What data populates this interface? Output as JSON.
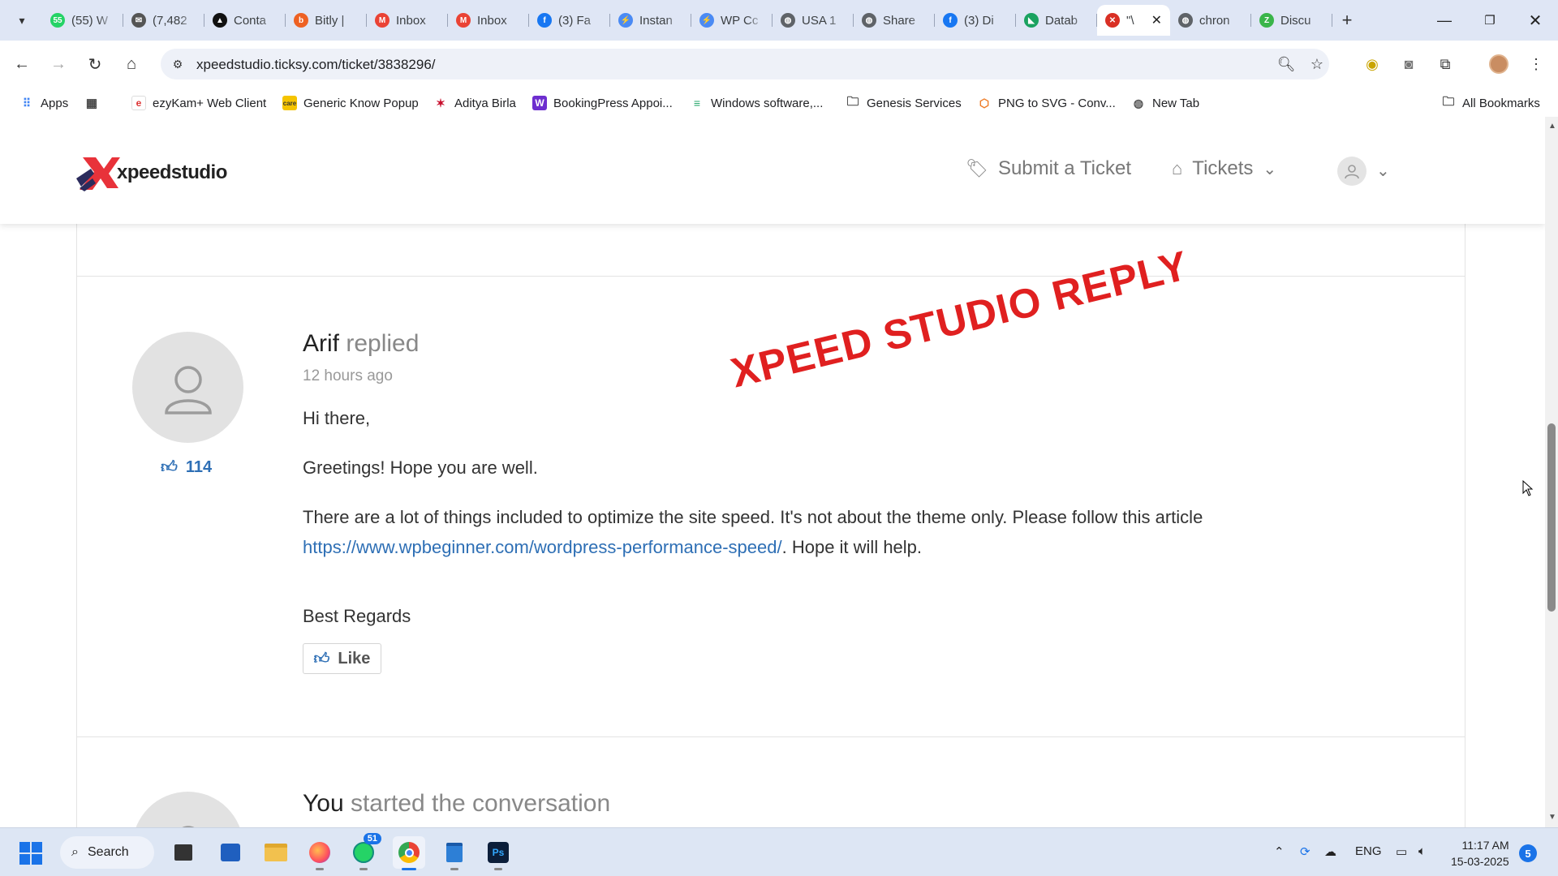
{
  "browser": {
    "tabs": [
      {
        "label": "(55) W",
        "color": "#25d366",
        "glyph": "55"
      },
      {
        "label": "(7,482",
        "color": "#555555",
        "glyph": "✉"
      },
      {
        "label": "Conta",
        "color": "#111111",
        "glyph": "▲"
      },
      {
        "label": "Bitly |",
        "color": "#ee6123",
        "glyph": "b"
      },
      {
        "label": "Inbox",
        "color": "#ea4335",
        "glyph": "M"
      },
      {
        "label": "Inbox",
        "color": "#ea4335",
        "glyph": "M"
      },
      {
        "label": "(3) Fa",
        "color": "#1877f2",
        "glyph": "f"
      },
      {
        "label": "Instan",
        "color": "#4a8af4",
        "glyph": "⚡"
      },
      {
        "label": "WP Cc",
        "color": "#4a8af4",
        "glyph": "⚡"
      },
      {
        "label": "USA 1",
        "color": "#5f6368",
        "glyph": "◍"
      },
      {
        "label": "Share",
        "color": "#5f6368",
        "glyph": "◍"
      },
      {
        "label": "(3) Di",
        "color": "#1877f2",
        "glyph": "f"
      },
      {
        "label": "Datab",
        "color": "#1aa260",
        "glyph": "◣"
      },
      {
        "label": "\"\\",
        "color": "#d93025",
        "glyph": "✕",
        "active": true
      },
      {
        "label": "chron",
        "color": "#5f6368",
        "glyph": "◍"
      },
      {
        "label": "Discu",
        "color": "#3ab54a",
        "glyph": "Z"
      }
    ],
    "url": "xpeedstudio.ticksy.com/ticket/3838296/",
    "bookmarks": [
      {
        "label": "Apps"
      },
      {
        "label": ""
      },
      {
        "label": "ezyKam+ Web Client"
      },
      {
        "label": "Generic Know Popup"
      },
      {
        "label": "Aditya Birla"
      },
      {
        "label": "BookingPress Appoi..."
      },
      {
        "label": "Windows software,..."
      },
      {
        "label": "Genesis Services"
      },
      {
        "label": "PNG to SVG - Conv..."
      },
      {
        "label": "New Tab"
      },
      {
        "label": "All Bookmarks"
      }
    ]
  },
  "site": {
    "logo_text": "xpeedstudio",
    "nav_submit": "Submit a Ticket",
    "nav_tickets": "Tickets"
  },
  "reply": {
    "author": "Arif",
    "verb": "replied",
    "time": "12 hours ago",
    "votes": "114",
    "greeting": "Hi there,",
    "line2": "Greetings! Hope you are well.",
    "line3_a": "There are a lot of things included to optimize the site speed. It's not about the theme only. Please follow this article ",
    "link": "https://www.wpbeginner.com/wordpress-performance-speed/",
    "line3_b": ". Hope it will help.",
    "signoff": "Best Regards",
    "like_label": "Like"
  },
  "stamp": "XPEED STUDIO REPLY",
  "next_entry": {
    "author": "You",
    "verb": "started the conversation"
  },
  "taskbar": {
    "search_label": "Search",
    "whatsapp_badge": "51",
    "lang": "ENG",
    "time": "11:17 AM",
    "date": "15-03-2025",
    "notifications": "5"
  },
  "colors": {
    "accent_blue": "#2e6fb5",
    "stamp_red": "#e02020",
    "tab_strip": "#dfe6f5"
  }
}
